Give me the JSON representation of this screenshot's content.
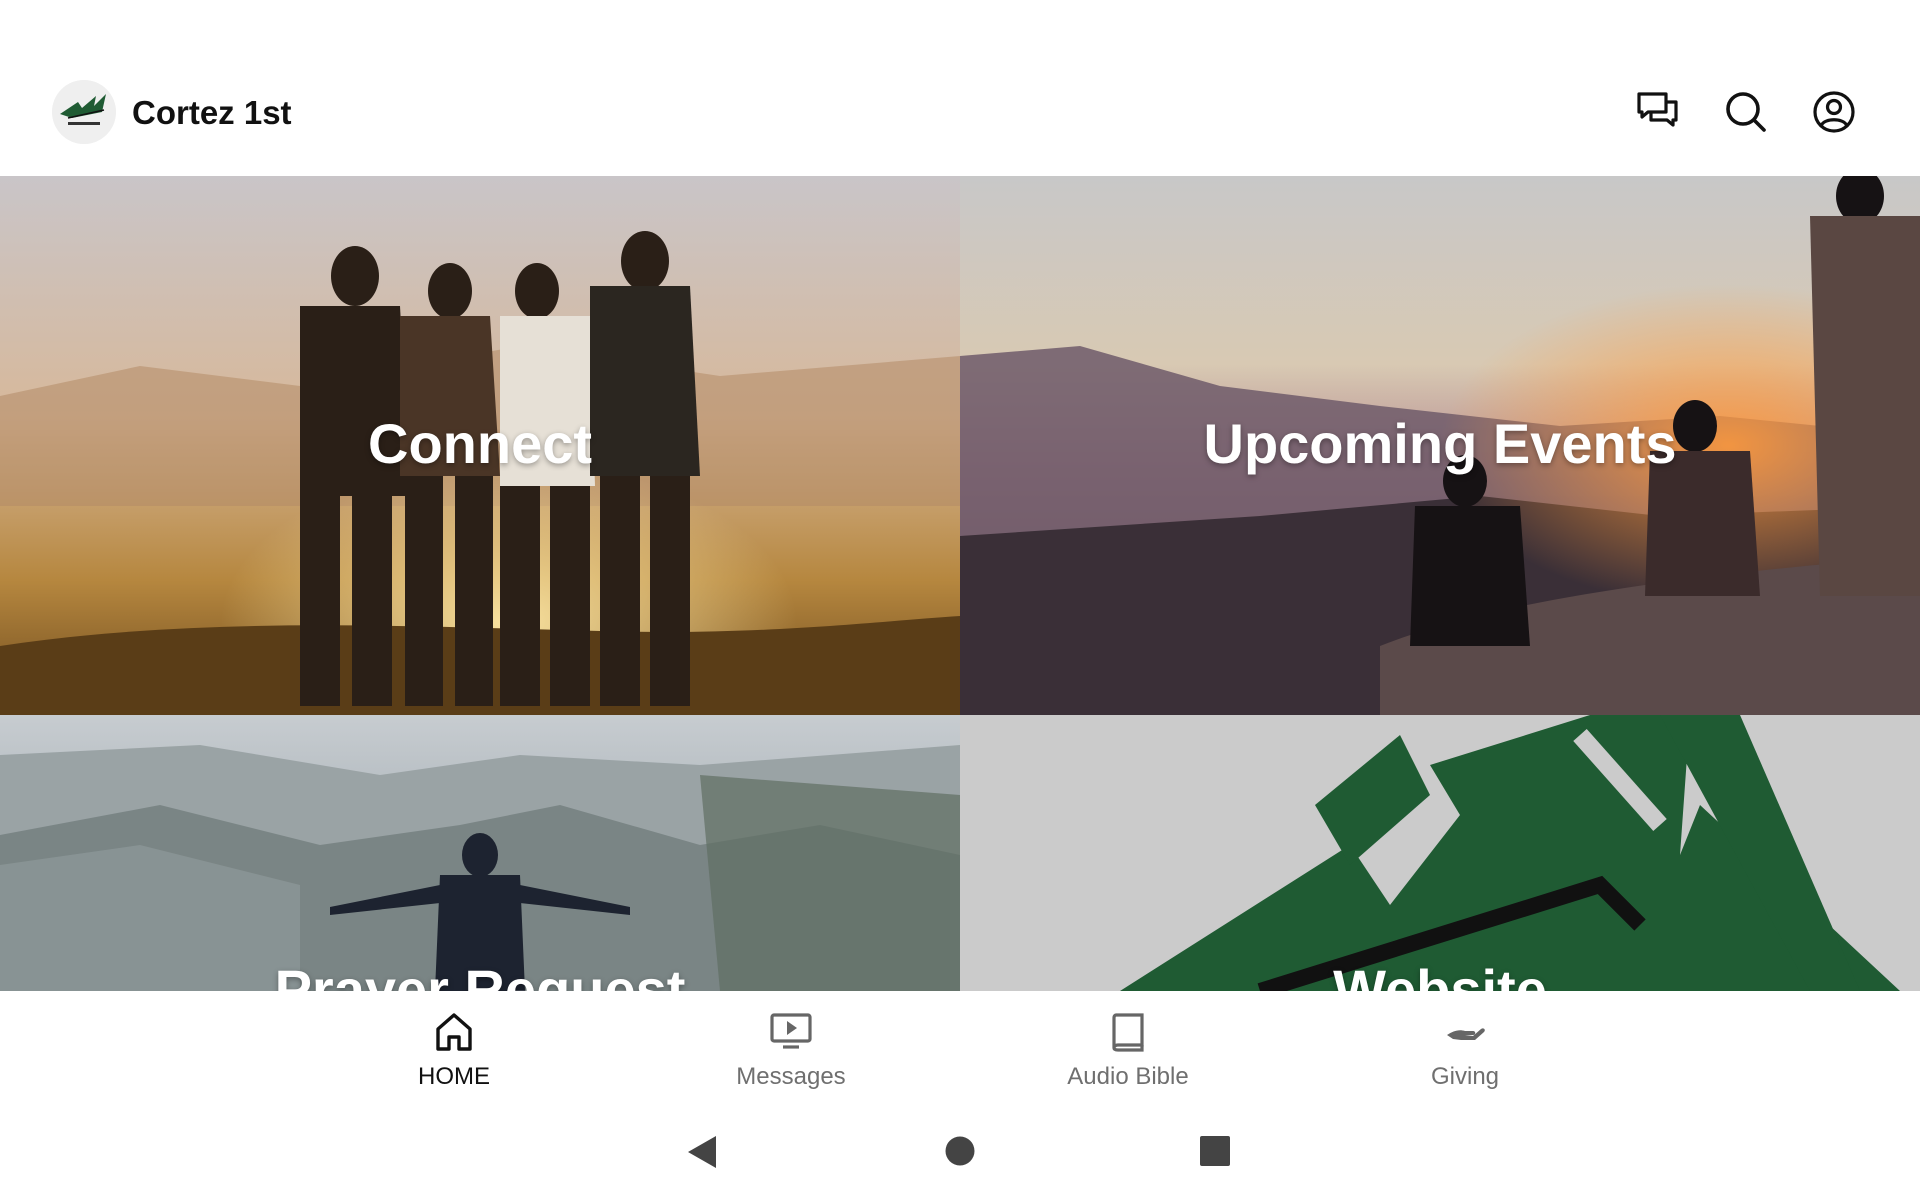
{
  "app": {
    "title": "Cortez 1st",
    "logo_icon": "church-logo-icon",
    "brand_color": "#1f5b33"
  },
  "header_actions": [
    {
      "name": "chat-icon"
    },
    {
      "name": "search-icon"
    },
    {
      "name": "account-icon"
    }
  ],
  "tiles": [
    {
      "label": "Connect"
    },
    {
      "label": "Upcoming Events"
    },
    {
      "label": "Prayer Request"
    },
    {
      "label": "Website"
    }
  ],
  "bottom_nav": [
    {
      "label": "HOME",
      "icon": "home-icon",
      "active": true
    },
    {
      "label": "Messages",
      "icon": "tv-play-icon",
      "active": false
    },
    {
      "label": "Audio Bible",
      "icon": "book-icon",
      "active": false
    },
    {
      "label": "Giving",
      "icon": "giving-hand-icon",
      "active": false
    }
  ],
  "system_nav": [
    {
      "icon": "back-triangle-icon"
    },
    {
      "icon": "home-circle-icon"
    },
    {
      "icon": "recents-square-icon"
    }
  ]
}
